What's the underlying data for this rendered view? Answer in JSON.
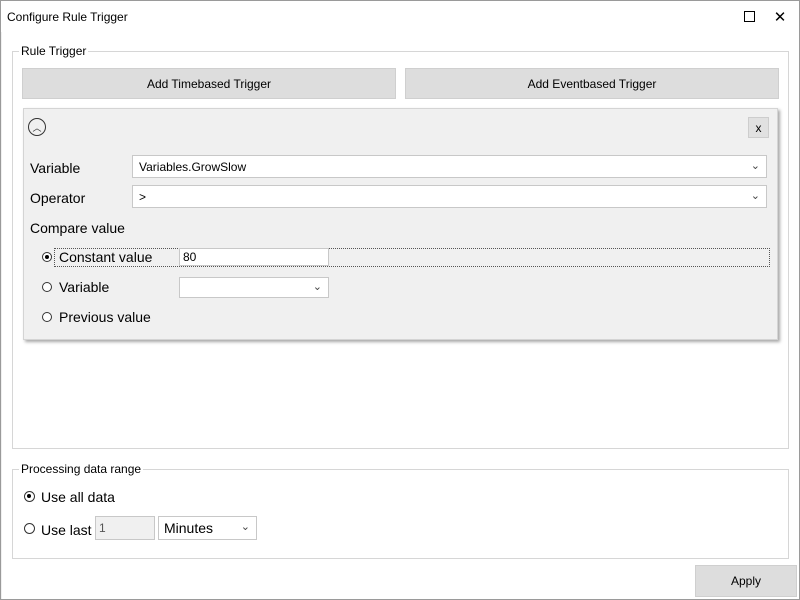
{
  "window": {
    "title": "Configure Rule Trigger"
  },
  "rule_trigger": {
    "group_label": "Rule Trigger",
    "add_timebased_label": "Add Timebased Trigger",
    "add_eventbased_label": "Add Eventbased Trigger",
    "panel": {
      "remove_label": "x",
      "variable_label": "Variable",
      "variable_value": "Variables.GrowSlow",
      "operator_label": "Operator",
      "operator_value": ">",
      "compare_value_label": "Compare value",
      "options": [
        {
          "label": "Constant value",
          "selected": true
        },
        {
          "label": "Variable",
          "selected": false
        },
        {
          "label": "Previous value",
          "selected": false
        }
      ],
      "constant_value": "80",
      "variable_select_value": ""
    }
  },
  "processing": {
    "group_label": "Processing data range",
    "use_all_label": "Use all data",
    "use_last_label": "Use last",
    "use_last_count": "1",
    "unit_value": "Minutes",
    "selected": "use_all"
  },
  "footer": {
    "apply_label": "Apply"
  }
}
